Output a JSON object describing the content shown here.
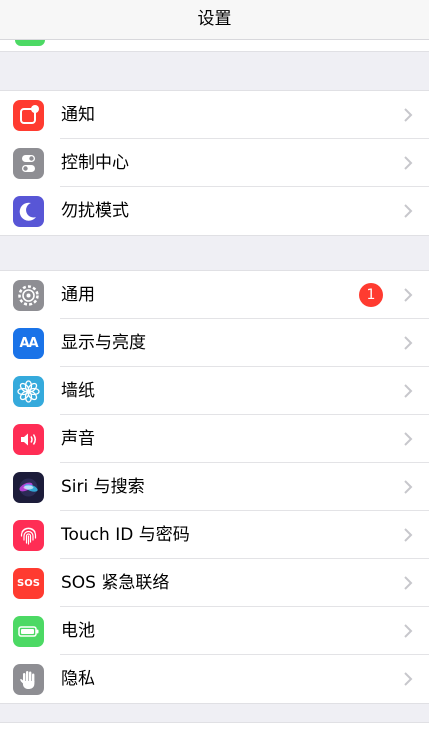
{
  "nav": {
    "title": "设置"
  },
  "colors": {
    "notifications": "#ff3b30",
    "control_center": "#8e8e93",
    "do_not_disturb": "#5856d6",
    "general": "#8e8e93",
    "display": "#1a73e8",
    "wallpaper": "#35aadc",
    "sounds": "#ff2d55",
    "siri": "#1c1c3a",
    "touch_id": "#ff2d55",
    "sos": "#ff3b30",
    "battery": "#4cd964",
    "privacy": "#8e8e93",
    "badge": "#ff3b30"
  },
  "group1": {
    "items": [
      {
        "label": "通知",
        "icon": "notifications-icon"
      },
      {
        "label": "控制中心",
        "icon": "control-center-icon"
      },
      {
        "label": "勿扰模式",
        "icon": "moon-icon"
      }
    ]
  },
  "group2": {
    "items": [
      {
        "label": "通用",
        "icon": "gear-icon",
        "badge": "1"
      },
      {
        "label": "显示与亮度",
        "icon": "display-aa-icon",
        "icon_text": "AA"
      },
      {
        "label": "墙纸",
        "icon": "wallpaper-flower-icon"
      },
      {
        "label": "声音",
        "icon": "speaker-icon"
      },
      {
        "label": "Siri 与搜索",
        "icon": "siri-icon"
      },
      {
        "label": "Touch ID 与密码",
        "icon": "fingerprint-icon"
      },
      {
        "label": "SOS 紧急联络",
        "icon": "sos-icon",
        "icon_text": "SOS"
      },
      {
        "label": "电池",
        "icon": "battery-icon"
      },
      {
        "label": "隐私",
        "icon": "hand-icon"
      }
    ]
  }
}
